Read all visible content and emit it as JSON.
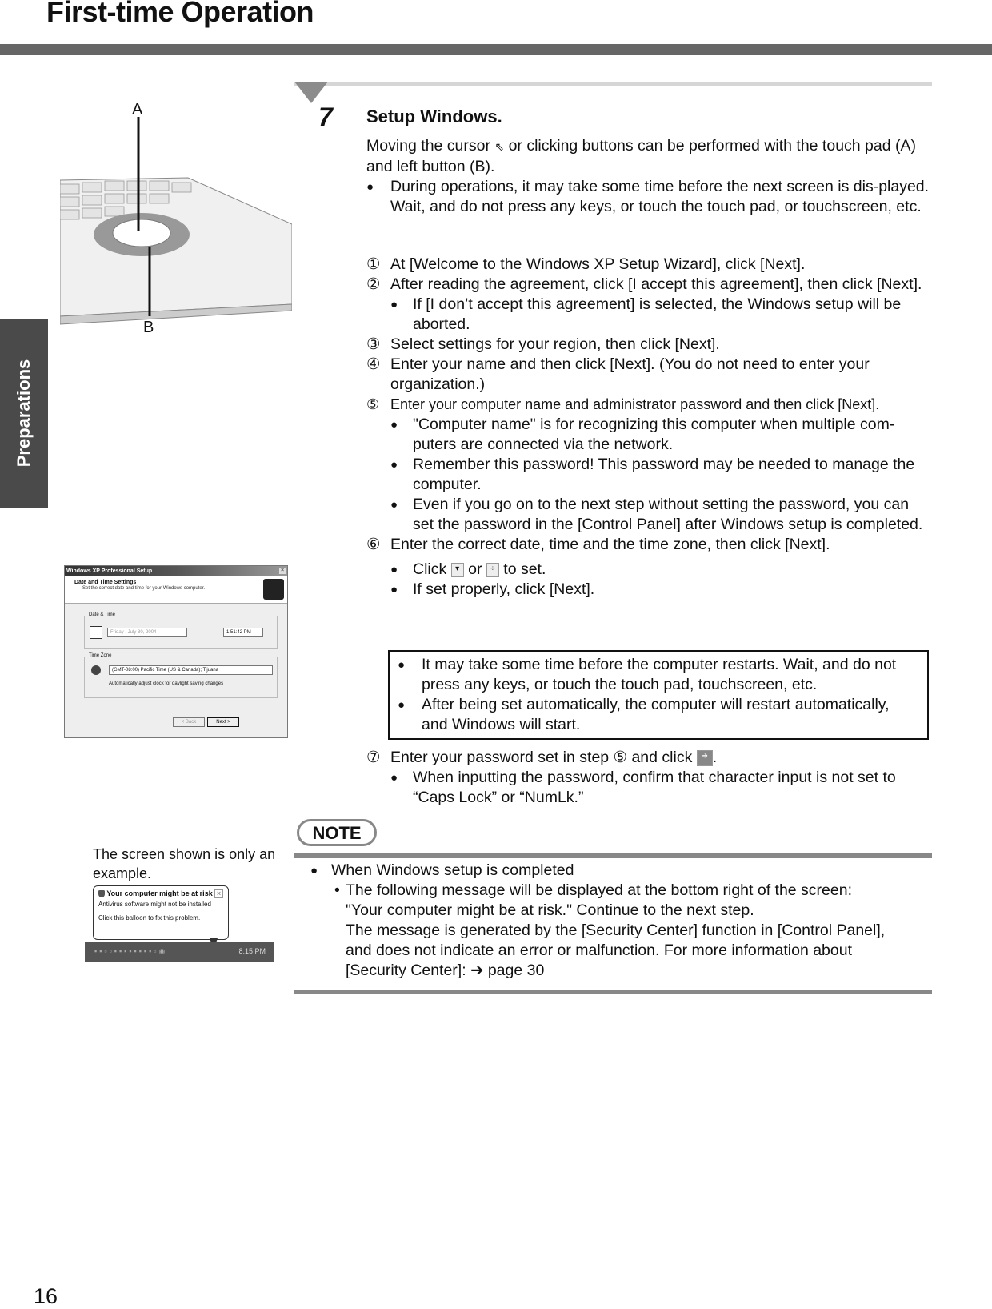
{
  "header": {
    "title": "First-time Operation"
  },
  "side_tab": {
    "label": "Preparations"
  },
  "page_number": "16",
  "step": {
    "number": "7",
    "title": "Setup Windows.",
    "intro_part1": "Moving the cursor",
    "intro_part2": "or clicking buttons can be performed with the touch pad (A) and left button (B).",
    "intro_bullet_line1": "During operations, it may take some time before the next screen is dis-played.",
    "intro_bullet_line2": "Wait, and do not press any keys, or touch the touch pad, or touchscreen, etc.",
    "items": [
      {
        "marker": "①",
        "text": "At [Welcome to the Windows XP Setup Wizard], click [Next]."
      },
      {
        "marker": "②",
        "text": "After reading the agreement, click [I accept this agreement], then click [Next].",
        "bullets": [
          "If [I don’t accept this agreement] is selected, the Windows setup will be aborted."
        ]
      },
      {
        "marker": "③",
        "text": "Select settings for your region, then click [Next]."
      },
      {
        "marker": "④",
        "text": "Enter your name and then click [Next]. (You do not need to enter your organization.)"
      },
      {
        "marker": "⑤",
        "text": "Enter your computer name and administrator password and then click [Next].",
        "bullets": [
          "\"Computer name\" is for recognizing this computer when multiple com-puters are connected via the network.",
          "Remember this password! This password may be needed to manage the computer.",
          "Even if you go on to the next step without setting the password, you can set the password in the [Control Panel] after Windows setup is completed."
        ]
      },
      {
        "marker": "⑥",
        "text": "Enter the correct date, time and the time zone, then click [Next].",
        "click_prefix": "Click",
        "click_or": "or",
        "click_suffix": "to set.",
        "bullet2": "If set properly, click [Next]."
      },
      {
        "marker": "⑦",
        "text_part1": "Enter your password set in step ⑤ and click",
        "text_part2": ".",
        "bullets": [
          "When inputting the password, confirm that character input is not set to “Caps Lock” or “NumLk.”"
        ]
      }
    ],
    "warning_box": [
      "It may take some time before the computer restarts. Wait, and do not press any keys, or touch the touch pad, touchscreen, etc.",
      "After being set automatically, the computer will restart automatically, and Windows will start."
    ]
  },
  "bullet_glyph": "●",
  "laptop_figure": {
    "label_a": "A",
    "label_b": "B"
  },
  "xp_dialog": {
    "title": "Windows XP Professional Setup",
    "close": "×",
    "heading": "Date and Time Settings",
    "subheading": "Set the correct date and time for your Windows computer.",
    "date_time_group": "Date & Time",
    "date_value": "Friday   ,   July   30, 2004",
    "time_value": "1:51:42 PM",
    "time_zone_group": "Time Zone",
    "time_zone_value": "(GMT-08:00) Pacific Time (US & Canada); Tijuana",
    "dst_checkbox": "Automatically adjust clock for daylight saving changes",
    "back_button": "< Back",
    "next_button": "Next >"
  },
  "note": {
    "badge": "NOTE",
    "sample_caption": "The screen shown is only an example.",
    "bullet": "When Windows setup is completed",
    "sub_line1": "The following message will be displayed at the bottom right of the screen:",
    "sub_line2": "\"Your computer might be at risk.\" Continue to the next step.",
    "sub_line3": "The message is generated by the [Security Center] function in [Control Panel], and does not indicate an error or malfunction. For more information about [Security Center]:",
    "arrow": "➔",
    "page_ref": "page 30",
    "sub_marker": "•"
  },
  "balloon": {
    "title": "Your computer might be at risk",
    "line1": "Antivirus software might not be installed",
    "line2": "Click this balloon to fix this problem.",
    "close": "×",
    "clock": "8:15 PM"
  },
  "icons": {
    "dropdown": "▾",
    "spinner": "÷",
    "next_arrow": "➔",
    "cursor": "⇖"
  }
}
